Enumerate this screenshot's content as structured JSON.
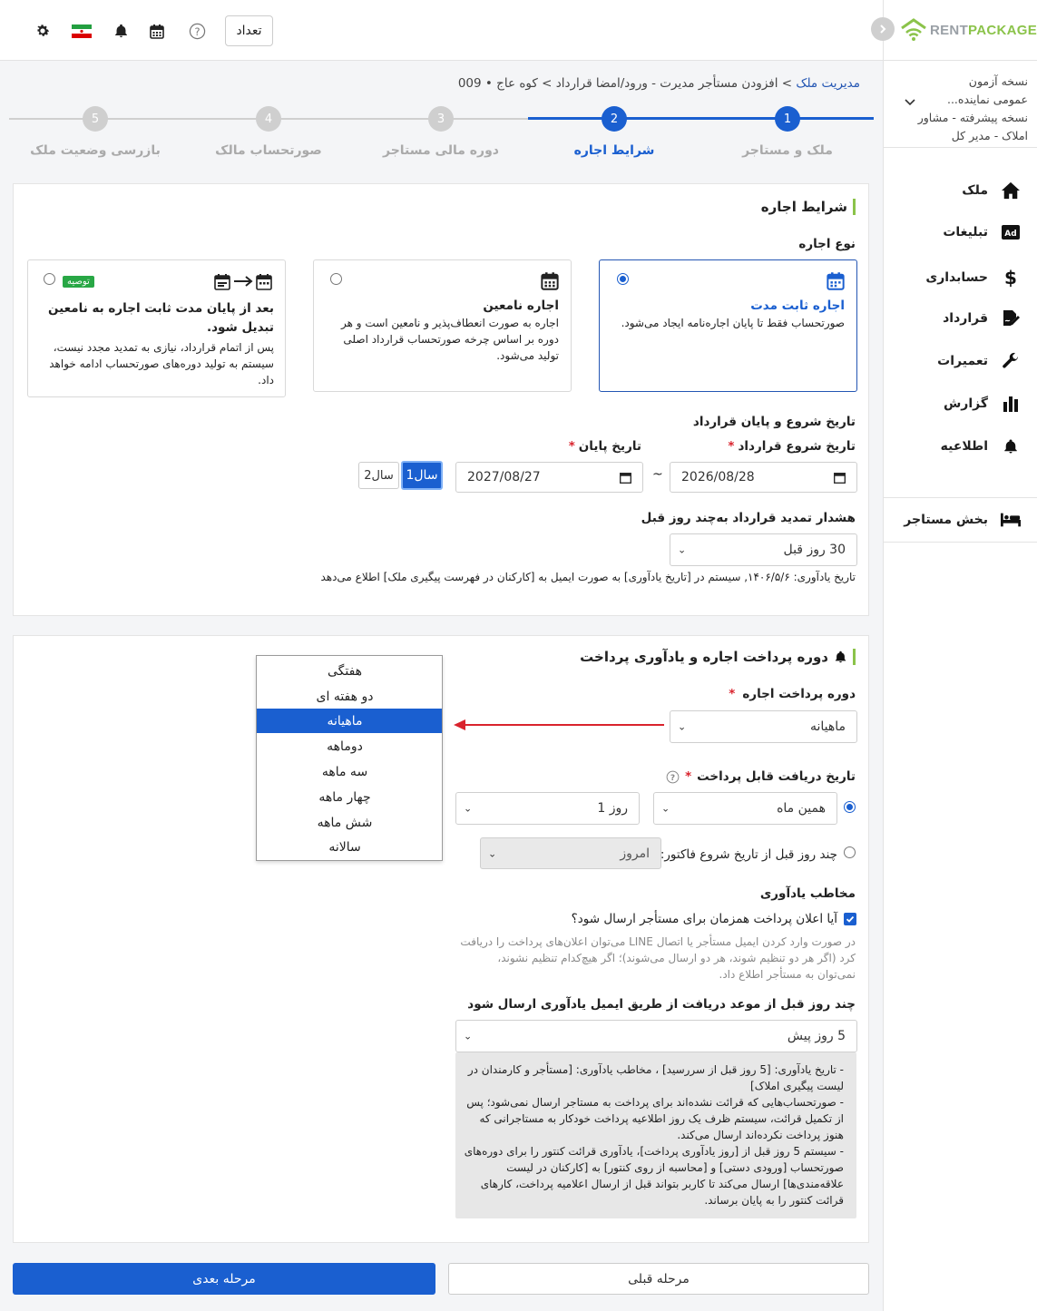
{
  "topbar": {
    "count_label": "تعداد",
    "icons": [
      "gear-icon",
      "flag-icon",
      "bell-icon",
      "calendar-icon",
      "help-icon"
    ]
  },
  "brand": {
    "rent": "RENT",
    "package": "PACKAGE"
  },
  "account": {
    "line1": "نسخه آزمون",
    "line2": "عمومی نماینده...",
    "line3": "نسخه پیشرفته - مشاور",
    "line4": "املاک - مدیر کل"
  },
  "sidebar": {
    "items": [
      {
        "label": "ملک",
        "icon": "home-icon"
      },
      {
        "label": "تبلیغات",
        "icon": "ad-icon"
      },
      {
        "label": "حسابداری",
        "icon": "dollar-icon"
      },
      {
        "label": "قرارداد",
        "icon": "contract-icon"
      },
      {
        "label": "تعمیرات",
        "icon": "wrench-icon"
      },
      {
        "label": "گزارش",
        "icon": "chart-icon"
      },
      {
        "label": "اطلاعیه",
        "icon": "bell-icon"
      }
    ],
    "tenant_section": {
      "label": "بخش مستاجر",
      "icon": "bed-icon"
    }
  },
  "breadcrumb": {
    "root": "مدیریت ملک",
    "rest": " > افزودن مستأجر مدیرت - ورود/امضا قرارداد > کوه عاج • 009"
  },
  "stepper": {
    "steps": [
      {
        "num": "1",
        "label": "ملک و مستاجر",
        "state": "done"
      },
      {
        "num": "2",
        "label": "شرایط اجاره",
        "state": "active"
      },
      {
        "num": "3",
        "label": "دوره مالی مستاجر",
        "state": "todo"
      },
      {
        "num": "4",
        "label": "صورتحساب مالک",
        "state": "todo"
      },
      {
        "num": "5",
        "label": "بازرسی وضعیت ملک",
        "state": "todo"
      }
    ]
  },
  "lease_terms": {
    "title": "شرایط اجاره",
    "type_label": "نوع اجاره",
    "options": [
      {
        "title": "اجاره ثابت مدت",
        "desc": "صورتحساب فقط تا پایان اجاره‌نامه ایجاد می‌شود.",
        "selected": true
      },
      {
        "title": "اجاره نامعین",
        "desc": "اجاره به صورت انعطاف‌پذیر و نامعین است و هر دوره بر اساس چرخه صورتحساب قرارداد اصلی تولید می‌شود.",
        "selected": false
      },
      {
        "title": "بعد از پایان مدت ثابت اجاره به نامعین تبدیل شود.",
        "desc": "پس از اتمام قرارداد، نیازی به تمدید مجدد نیست، سیستم به تولید دوره‌های صورتحساب ادامه خواهد داد.",
        "badge": "توصیه",
        "selected": false
      }
    ],
    "dates_label": "تاریخ شروع و پایان قرارداد",
    "start_label": "تاریخ شروع قرارداد",
    "end_label": "تاریخ پایان",
    "start_value": "2026/08/28",
    "end_value": "2027/08/27",
    "tilde": "~",
    "year1": "1سال",
    "year2": "2سال",
    "renew_label": "هشدار تمدید قرارداد به‌چند روز قبل",
    "renew_value": "30 روز قبل",
    "renew_note": "تاریخ یادآوری: ۱۴۰۶/۵/۶, سیستم در [تاریخ یادآوری] به صورت ایمیل به [کارکنان در فهرست پیگیری ملک] اطلاع می‌دهد"
  },
  "payment": {
    "title": "دوره پرداخت اجاره و یادآوری پرداخت",
    "period_label": "دوره پرداخت اجاره",
    "period_value": "ماهیانه",
    "period_options": [
      "هفتگی",
      "دو هفته ای",
      "ماهیانه",
      "دوماهه",
      "سه ماهه",
      "چهار ماهه",
      "شش ماهه",
      "سالانه"
    ],
    "selected_index": 2,
    "due_label": "تاریخ دریافت قابل پرداخت",
    "due_month": "همین ماه",
    "due_day": "روز 1",
    "before_label": "چند روز قبل از تاریخ شروع فاکتور:",
    "before_value": "امروز",
    "contact_label": "مخاطب یادآوری",
    "notify_label": "آیا اعلان پرداخت همزمان برای مستأجر ارسال شود؟",
    "notify_note": "در صورت وارد کردن ایمیل مستأجر یا اتصال LINE می‌توان اعلان‌های پرداخت را دریافت کرد (اگر هر دو تنظیم شوند، هر دو ارسال می‌شوند)؛ اگر هیچ‌کدام تنظیم نشوند، نمی‌توان به مستأجر اطلاع داد.",
    "email_days_label": "چند روز قبل از موعد دریافت از طریق ایمیل یادآوری ارسال شود",
    "email_days_value": "5 روز پیش",
    "info": [
      "- تاریخ یادآوری: [5 روز قبل از سررسید] ، مخاطب یادآوری: [مستأجر و کارمندان در لیست پیگیری املاک]",
      "- صورتحساب‌هایی که قرائت نشده‌اند برای پرداخت به مستاجر ارسال نمی‌شود؛ پس از تکمیل قرائت، سیستم ظرف یک روز اطلاعیه پرداخت خودکار به مستاجرانی که هنوز پرداخت نکرده‌اند ارسال می‌کند.",
      "- سیستم 5 روز قبل از [روز یادآوری پرداخت]، یادآوری قرائت کنتور را برای دوره‌های صورتحساب [ورودی دستی] و [محاسبه از روی کنتور] به [کارکنان در لیست علاقه‌مندی‌ها] ارسال می‌کند تا کاربر بتواند قبل از ارسال اعلامیه پرداخت، کارهای قرائت کنتور را به پایان برساند."
    ]
  },
  "footer": {
    "next": "مرحله بعدی",
    "prev": "مرحله قبلی"
  },
  "colors": {
    "primary": "#1a5fd0",
    "accent_green": "#8bc34a",
    "required": "#d9232d"
  }
}
